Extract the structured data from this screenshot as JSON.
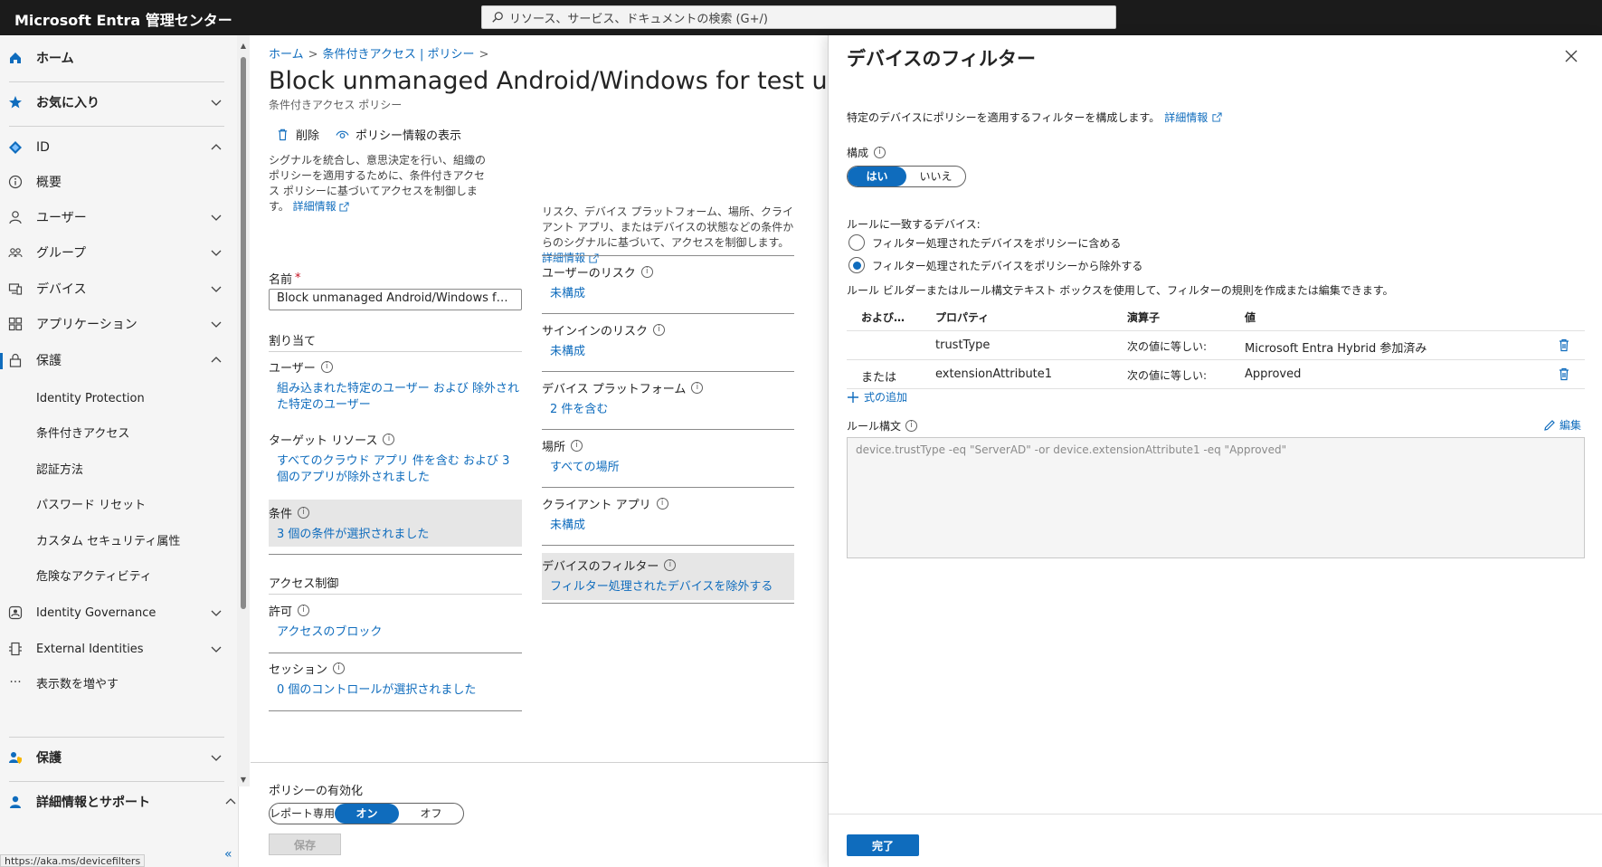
{
  "topbar": {
    "brand": "Microsoft Entra 管理センター",
    "search_placeholder": "リソース、サービス、ドキュメントの検索 (G+/)"
  },
  "sidebar": {
    "home": "ホーム",
    "favorites": "お気に入り",
    "id": "ID",
    "overview": "概要",
    "users": "ユーザー",
    "groups": "グループ",
    "devices": "デバイス",
    "applications": "アプリケーション",
    "protection": "保護",
    "protection_sub": [
      "Identity Protection",
      "条件付きアクセス",
      "認証方法",
      "パスワード リセット",
      "カスタム セキュリティ属性",
      "危険なアクティビティ"
    ],
    "identity_governance": "Identity Governance",
    "external_identities": "External Identities",
    "show_more": "表示数を増やす",
    "protection2": "保護",
    "learn_support": "詳細情報とサポート",
    "collapse": "«",
    "status_url": "https://aka.ms/devicefilters"
  },
  "main": {
    "breadcrumb": [
      "ホーム",
      "条件付きアクセス | ポリシー"
    ],
    "title": "Block unmanaged Android/Windows for test users",
    "subtitle": "条件付きアクセス ポリシー",
    "cmd_delete": "削除",
    "cmd_view_info": "ポリシー情報の表示",
    "left_desc": "シグナルを統合し、意思決定を行い、組織のポリシーを適用するために、条件付きアクセス ポリシーに基づいてアクセスを制御します。",
    "learn_more": "詳細情報",
    "name_label": "名前",
    "required_mark": "*",
    "name_value": "Block unmanaged Android/Windows fo…",
    "assignments": "割り当て",
    "users_label": "ユーザー",
    "users_value": "組み込まれた特定のユーザー および 除外された特定のユーザー",
    "target_label": "ターゲット リソース",
    "target_value": "すべてのクラウド アプリ 件を含む および 3 個のアプリが除外されました",
    "conditions_label": "条件",
    "conditions_value": "3 個の条件が選択されました",
    "access_controls": "アクセス制御",
    "grant_label": "許可",
    "grant_value": "アクセスのブロック",
    "session_label": "セッション",
    "session_value": "0 個のコントロールが選択されました",
    "right_desc": "リスク、デバイス プラットフォーム、場所、クライアント アプリ、またはデバイスの状態などの条件からのシグナルに基づいて、アクセスを制御します。",
    "user_risk_label": "ユーザーのリスク",
    "user_risk_value": "未構成",
    "signin_risk_label": "サインインのリスク",
    "signin_risk_value": "未構成",
    "platform_label": "デバイス プラットフォーム",
    "platform_value": "2 件を含む",
    "locations_label": "場所",
    "locations_value": "すべての場所",
    "client_apps_label": "クライアント アプリ",
    "client_apps_value": "未構成",
    "device_filter_label": "デバイスのフィルター",
    "device_filter_value": "フィルター処理されたデバイスを除外する",
    "enable_policy": "ポリシーの有効化",
    "toggle_options": [
      "レポート専用",
      "オン",
      "オフ"
    ],
    "save": "保存"
  },
  "flyout": {
    "title": "デバイスのフィルター",
    "description": "特定のデバイスにポリシーを適用するフィルターを構成します。",
    "learn_more": "詳細情報",
    "configure_label": "構成",
    "yes": "はい",
    "no": "いいえ",
    "matching_label": "ルールに一致するデバイス:",
    "radio_include": "フィルター処理されたデバイスをポリシーに含める",
    "radio_exclude": "フィルター処理されたデバイスをポリシーから除外する",
    "builder_note": "ルール ビルダーまたはルール構文テキスト ボックスを使用して、フィルターの規則を作成または編集できます。",
    "table_headers": [
      "および…",
      "プロパティ",
      "演算子",
      "値"
    ],
    "rows": [
      {
        "andor": "",
        "property": "trustType",
        "operator": "次の値に等しい:",
        "value": "Microsoft Entra Hybrid 参加済み"
      },
      {
        "andor": "または",
        "property": "extensionAttribute1",
        "operator": "次の値に等しい:",
        "value": "Approved"
      }
    ],
    "add_expression": "式の追加",
    "rule_syntax_label": "ルール構文",
    "edit": "編集",
    "rule_syntax": "device.trustType -eq \"ServerAD\" -or device.extensionAttribute1 -eq \"Approved\"",
    "done": "完了"
  },
  "colors": {
    "accent": "#0f6cbd",
    "topbar": "#1b1b1b"
  }
}
